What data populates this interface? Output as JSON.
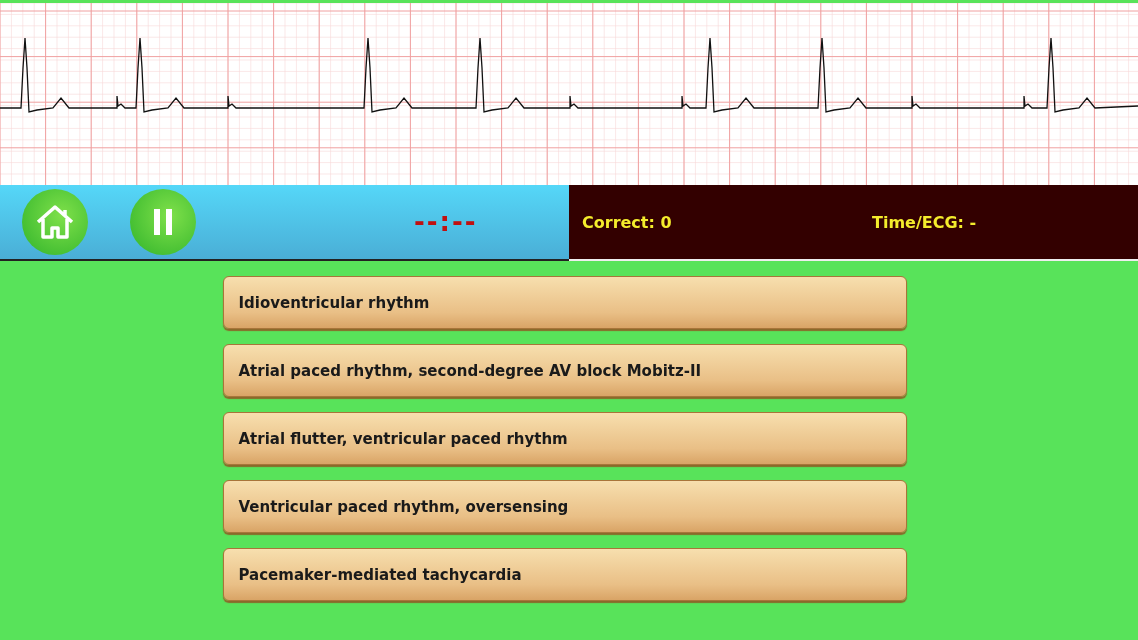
{
  "toolbar": {
    "timer": "--:--",
    "correct": "Correct: 0",
    "time_per_ecg": "Time/ECG: -"
  },
  "answers": [
    {
      "label": "Idioventricular rhythm"
    },
    {
      "label": "Atrial paced rhythm, second-degree AV block Mobitz-II"
    },
    {
      "label": "Atrial flutter, ventricular paced rhythm"
    },
    {
      "label": "Ventricular paced rhythm, oversensing"
    },
    {
      "label": "Pacemaker-mediated tachycardia"
    }
  ]
}
